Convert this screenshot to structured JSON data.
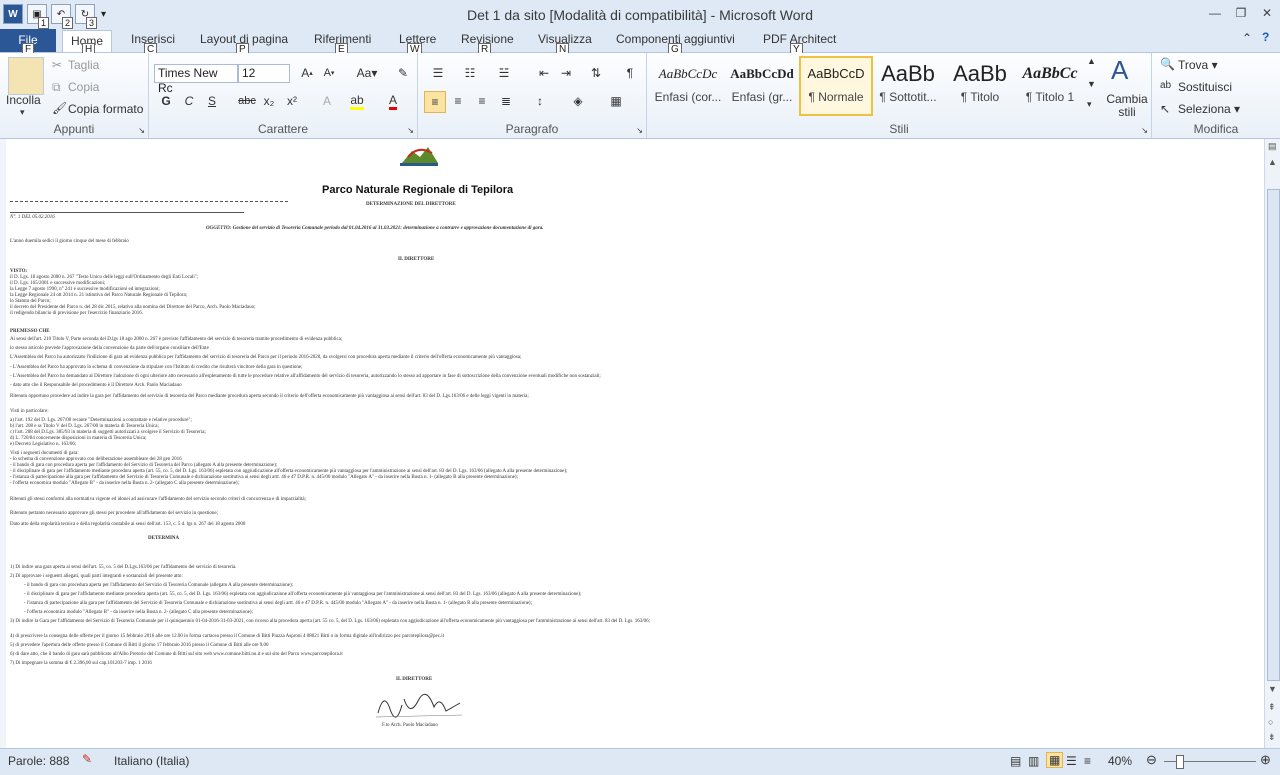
{
  "window": {
    "title": "Det 1 da sito [Modalità di compatibilità]  -  Microsoft Word",
    "qat_badges": [
      "1",
      "2",
      "3"
    ]
  },
  "tabs": [
    {
      "label": "File",
      "key": "F"
    },
    {
      "label": "Home",
      "key": "H"
    },
    {
      "label": "Inserisci",
      "key": "C"
    },
    {
      "label": "Layout di pagina",
      "key": "P"
    },
    {
      "label": "Riferimenti",
      "key": "E"
    },
    {
      "label": "Lettere",
      "key": "W"
    },
    {
      "label": "Revisione",
      "key": "R"
    },
    {
      "label": "Visualizza",
      "key": "N"
    },
    {
      "label": "Componenti aggiuntivi",
      "key": "G"
    },
    {
      "label": "PDF Architect",
      "key": "Y"
    }
  ],
  "ribbon": {
    "appunti": {
      "label": "Appunti",
      "incolla": "Incolla",
      "taglia": "Taglia",
      "copia": "Copia",
      "copia_formato": "Copia formato"
    },
    "carattere": {
      "label": "Carattere",
      "font": "Times New Rc",
      "size": "12",
      "bold": "G",
      "italic": "C",
      "underline": "S",
      "strike": "abc"
    },
    "paragrafo": {
      "label": "Paragrafo"
    },
    "stili": {
      "label": "Stili",
      "items": [
        {
          "sample": "AaBbCcDc",
          "name": "Enfasi (cor..."
        },
        {
          "sample": "AaBbCcDd",
          "name": "Enfasi (gr..."
        },
        {
          "sample": "AaBbCcD",
          "name": "¶ Normale"
        },
        {
          "sample": "AaBb",
          "name": "¶ Sottotit..."
        },
        {
          "sample": "AaBb",
          "name": "¶ Titolo"
        },
        {
          "sample": "AaBbCc",
          "name": "¶ Titolo 1"
        }
      ],
      "cambia": "Cambia stili"
    },
    "modifica": {
      "label": "Modifica",
      "trova": "Trova",
      "sostituisci": "Sostituisci",
      "seleziona": "Seleziona"
    }
  },
  "document": {
    "heading": "Parco Naturale Regionale di Tepilora",
    "subheading": "DETERMINAZIONE DEL DIRETTORE",
    "number": "N°. 1 DEL  05.02.2016",
    "oggetto": "OGGETTO: Gestione del servizio di  Tesoreria Comunale periodo dal 01.04.2016 al 31.03.2021: determinazione a contrarre e approvazione documentazione di gara.",
    "date_line": "L'anno duemila sedici il giorno cinque del mese di febbraio",
    "il_direttore": "IL DIRETTORE",
    "visto_title": "VISTO:",
    "visto": [
      "il D. Lgs. 18 agosto 2000 n. 267 \"Testo Unico delle leggi sull'Ordinamento degli Enti Locali\";",
      "il D. Lgs. 165/2001 e successive modificazioni;",
      "la Legge 7 agosto 1990, n° 241 e successive modificazioni ed integrazioni;",
      "la Legge Regionale 24 ott 2014 n. 21 istitutiva del Parco Naturale Regionale di Tepilora;",
      "lo Statuto del Parco;",
      "il decreto del Presidente del Parco  n.   del 28 dic 2015, relativo alla nomina del Direttore del Parco, Arch. Paolo Maciadauo;",
      "il redigendo bilancio di previsione per l'esercizio finanziario 2016."
    ],
    "premesso_title": "PREMESSO CHE",
    "premesso": [
      "Ai sensi dell'art. 210 Titolo V, Parte seconda del D.lgs 18 ago 2000 n. 267 è previsto l'affidamento del servizio di tesoreria tramite procedimento di evidenza pubblica;",
      "lo stesso articolo prevede l'approvazione della convenzione da parte dell'organo consiliare dell'Ente",
      "L'Assemblea del Parco ha autorizzato l'indizione di gara ad evidenza pubblica per l'affidamento del servizio di tesoreria del Parco per il periodo 2016-2020, da svolgersi con procedura aperta mediante il criterio dell'offerta economicamente più vantaggiosa;",
      "- L'Assemblea del Parco ha approvato lo schema di convenzione da stipulare con l'Istituto di credito che risulterà vincitore della gara in questione;",
      "- L'Assemblea del Parco ha demandato al Direttore l'adozione di ogni ulteriore atto necessario all'espletamento di tutte le procedure relative all'affidamento del servizio di tesoreria, autorizzando lo stesso ad apportare in fase di sottoscrizione della convenzione eventuali modifiche non sostanziali;",
      "- dato atto che il Responsabile del procedimento è il Direttore Arch. Paolo Maciadauo"
    ],
    "ritenuto_1": "Ritenuto opportuno procedere ad indire la gara per l'affidamento del servizio di tesoreria del Parco mediante procedura aperta secondo il criterio dell'offerta economicamente più vantaggiosa ai sensi dell'art. 83 del D. Lgs.163/06 e delle leggi vigenti in materia;",
    "visti_title": "Visti in particolare:",
    "visti": [
      "a) l'art. 192 del D. Lgs. 267/00 recante \"Determinazioni a contrattare e relative procedure\";",
      "b) l'art. 208 e ss Titolo V del D. Lgs. 267/00 in materia di Tesoreria Unica;",
      "c) l'art. 208 del D.Lgs. 385/93 in materia di soggetti autorizzati a svolgere il Servizio di Tesoreria;",
      "d) L. 720/84 concernente disposizioni in materia di Tesoreria Unica;",
      "e) Decreto Legislativo n. 163/06;"
    ],
    "documenti_title": "Visti i seguenti documenti di gara:",
    "documenti": [
      "- lo schema di convenzione  approvato con deliberazione assembleare  del 28 gen 2016",
      "- il bando di gara con procedura aperta per l'affidamento del Servizio di Tesoreria del Parco (allegato A alla presente determinazione);",
      "- il disciplinare di gara per l'affidamento mediante procedura aperta (art. 55, co. 5, del                D. Lgs. 163/06) espletata con aggiudicazione all'offerta economicamente più vantaggiosa per l'amministrazione ai sensi dell'art. 83 del D. Lgs. 163/06 (allegato A alla presente determinazione);",
      "- l'istanza di partecipazione alla gara per l'affidamento del Servizio di Tesoreria Comunale e dichiarazione sostitutiva ai sensi degli artt. 46 e 47 D.P.R. n. 445/00 modulo \"Allegato A\" - da inserire nella Busta n. 1- (allegato B alla presente determinazione);",
      "- l'offerta economica modulo \"Allegato B\" - da inserire nella Busta n. 2- (allegato C alla presente determinazione);"
    ],
    "ritenuti_2": "Ritenuti gli stessi conformi alla normativa vigente ed idonei ad assicurare l'affidamento del servizio secondo criteri di concorrenza e di imparzialità;",
    "ritenuto_3": "Ritenuto pertanto necessario approvare gli stessi per procedere all'affidamento del servizio in questione;",
    "dato_atto": "Dato atto della regolarità tecnica e della regolarità contabile ai sensi dell'art. 153, c. 5 d. lgs n. 267 del 18 agosto 2000",
    "determina_title": "DETERMINA",
    "determina": [
      "1) Di indire una gara aperta ai sensi dell'art. 55, co. 5 del D.Lgs.163/06 per l'affidamento del servizio di tesoreria.",
      "2) Di approvare i seguenti allegati, quali parti integranti e sostanziali del presente atto:",
      "   - il bando di gara con procedura aperta per l'affidamento del Servizio di Tesoreria Comunale (allegato A alla presente determinazione);",
      "   - il disciplinare di gara per l'affidamento mediante procedura aperta (art. 55, co. 5, del D. Lgs. 163/06) espletata con aggiudicazione all'offerta economicamente più vantaggiosa per l'amministrazione ai sensi dell'art. 83 del D. Lgs. 163/06 (allegato A alla presente determinazione);",
      "   - l'istanza di partecipazione alla gara per l'affidamento del Servizio di Tesoreria Comunale e dichiarazione sostitutiva ai sensi degli artt. 46 e 47 D.P.R. n. 445/00 modulo \"Allegato A\" - da inserire nella Busta n. 1- (allegato B alla presente determinazione);",
      "   - l'offerta economica modulo \"Allegato B\" - da inserire nella Busta n. 2- (allegato C alla presente determinazione);",
      "3) Di indire la Gara per l'affidamento del Servizio di Tesoreria Comunale per il quinquennio 01-04-2016-31-03-2021, con ricorso alla procedura aperta (art. 55 co. 5, del D. Lgs. 163/06) espletata con aggiudicazione all'offerta economicamente più vantaggiosa per l'amministrazione ai sensi dell'art. 83 del D. Lgs. 163/06;",
      "4) di prescrivere la consegna delle offerte per il giorno 15 febbraio 2016 alle ore 12.00 in forma cartacea presso il Comune di Bitti Piazza Asproni 4 08021 Bitti o in forma digitale all'indirizzo pec parcotepilora@pec.it",
      "5) di prevedere l'apertura delle offerte presso il Comune di Bitti il giorno 17 febbraio 2016 presso il Comune di Bitti alle ore 9.00",
      "6) di dare atto, che il bando di gara sarà pubblicato all'Albo Pretorio del Comune di Bitti sul sito web www.comune.bitti.nu.it e sul sito del Parco www.parcotepilora.it",
      " 7) Di impegnare la somma di € 2.396,00 sul cap.101203-7 imp. 1 2016"
    ],
    "firma_title": "IL DIRETTORE",
    "firma": "F.to Arch. Paolo Maciadauo"
  },
  "status": {
    "words": "Parole: 888",
    "language": "Italiano (Italia)",
    "zoom": "40%"
  }
}
